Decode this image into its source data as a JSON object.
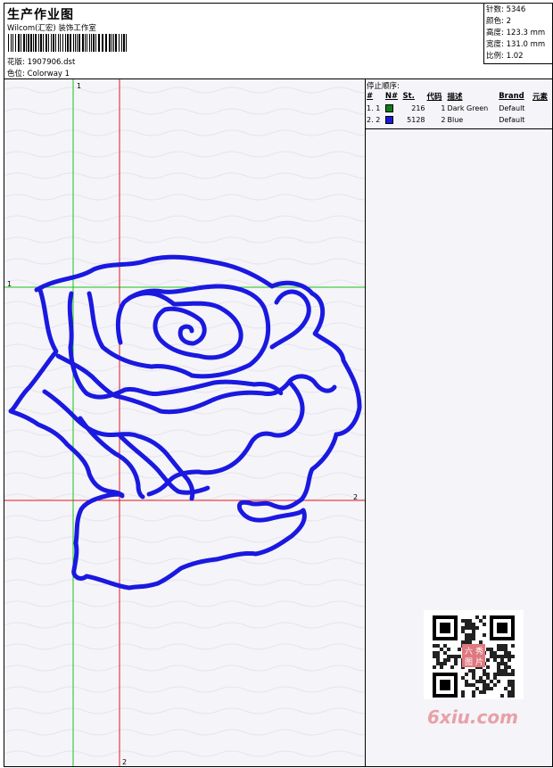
{
  "header": {
    "title": "生产作业图",
    "subtitle": "Wilcom(汇宏) 装饰工作室",
    "file_label": "花版: 1907906.dst",
    "colorway_label": "色位: Colorway 1"
  },
  "stats": [
    {
      "label": "针数",
      "value": "5346"
    },
    {
      "label": "颜色",
      "value": "2"
    },
    {
      "label": "高度",
      "value": "123.3 mm"
    },
    {
      "label": "宽度",
      "value": "131.0 mm"
    },
    {
      "label": "比例",
      "value": "1.02"
    }
  ],
  "stop_panel": {
    "title": "停止顺序:",
    "columns": [
      "#",
      "N#",
      "St.",
      "代码",
      "描述",
      "Brand",
      "元素"
    ],
    "rows": [
      {
        "idx": "1.",
        "n": "1",
        "color": "#0a7f17",
        "st": "216",
        "code": "1",
        "desc": "Dark Green",
        "brand": "Default"
      },
      {
        "idx": "2.",
        "n": "2",
        "color": "#1a19d9",
        "st": "5128",
        "code": "2",
        "desc": "Blue",
        "brand": "Default"
      }
    ]
  },
  "guides": {
    "green_v": "1",
    "green_h": "1",
    "red_v": "2",
    "red_h": "2"
  },
  "watermark": {
    "text": "6xiu.com",
    "stamp": "六秀图片"
  },
  "colors": {
    "stitch": "#1a19e0",
    "green_guide": "#19c419",
    "red_guide": "#dd1a1a"
  }
}
